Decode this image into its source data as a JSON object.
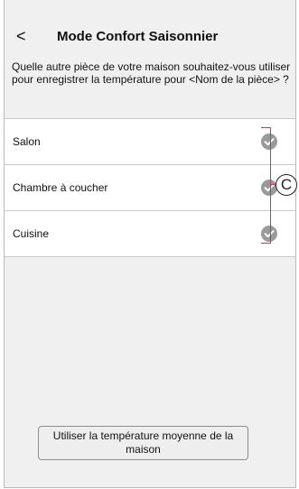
{
  "header": {
    "back_icon": "chevron-left-icon",
    "back_glyph": "<",
    "title": "Mode Confort Saisonnier"
  },
  "question": "Quelle autre pièce de votre maison souhaitez-vous utiliser pour enregistrer la température pour <Nom de la pièce> ?",
  "rooms": [
    {
      "label": "Salon",
      "icon": "check-circle-icon"
    },
    {
      "label": "Chambre à coucher",
      "icon": "check-circle-icon"
    },
    {
      "label": "Cuisine",
      "icon": "check-circle-icon"
    }
  ],
  "annotation": {
    "label": "C",
    "color": "#d0306a"
  },
  "footer": {
    "average_button_label": "Utiliser la température moyenne de la maison"
  },
  "colors": {
    "check_fill": "#9a9a9a",
    "background": "#f0f0f0"
  }
}
